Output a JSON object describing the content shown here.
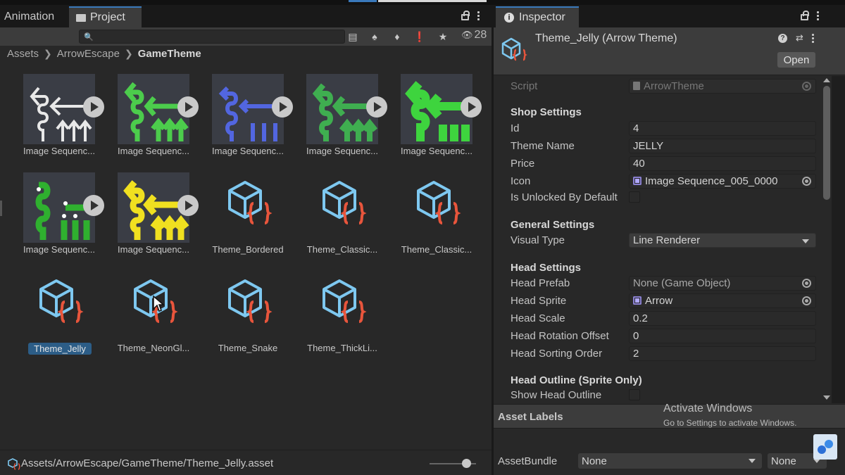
{
  "project": {
    "tabs": [
      {
        "label": "Animation",
        "icon": "animation-icon",
        "active": false
      },
      {
        "label": "Project",
        "icon": "folder-icon",
        "active": true
      }
    ],
    "search": {
      "placeholder": "",
      "value": ""
    },
    "toolbar_icons": [
      "search-by-type-icon",
      "filter-by-type-icon",
      "filter-by-label-icon",
      "warning-filter-icon",
      "favorite-icon"
    ],
    "visible_count": "28",
    "breadcrumb": [
      "Assets",
      "ArrowEscape",
      "GameTheme"
    ],
    "assets": [
      {
        "label": "Image Sequenc...",
        "type": "image-sequence",
        "colors": {
          "bg": "#3a3d45",
          "fg": "#e8e8e8"
        }
      },
      {
        "label": "Image Sequenc...",
        "type": "image-sequence",
        "colors": {
          "bg": "#3a3d45",
          "fg": "#4ccc4c"
        }
      },
      {
        "label": "Image Sequenc...",
        "type": "image-sequence",
        "colors": {
          "bg": "#3a3d45",
          "fg": "#5266e0"
        }
      },
      {
        "label": "Image Sequenc...",
        "type": "image-sequence",
        "colors": {
          "bg": "#3a3d45",
          "fg": "#3fae50"
        }
      },
      {
        "label": "Image Sequenc...",
        "type": "image-sequence",
        "colors": {
          "bg": "#3a3d45",
          "fg": "#3ed43e"
        }
      },
      {
        "label": "Image Sequenc...",
        "type": "image-sequence",
        "colors": {
          "bg": "#3a3d45",
          "fg": "#2fb02f"
        }
      },
      {
        "label": "Image Sequenc...",
        "type": "image-sequence",
        "colors": {
          "bg": "#3a3d45",
          "fg": "#f0e020"
        }
      },
      {
        "label": "Theme_Bordered",
        "type": "scriptable-object"
      },
      {
        "label": "Theme_Classic...",
        "type": "scriptable-object"
      },
      {
        "label": "Theme_Classic...",
        "type": "scriptable-object"
      },
      {
        "label": "Theme_Jelly",
        "type": "scriptable-object",
        "selected": true
      },
      {
        "label": "Theme_NeonGl...",
        "type": "scriptable-object"
      },
      {
        "label": "Theme_Snake",
        "type": "scriptable-object"
      },
      {
        "label": "Theme_ThickLi...",
        "type": "scriptable-object"
      }
    ],
    "status_path": "Assets/ArrowEscape/GameTheme/Theme_Jelly.asset",
    "zoom_level": 0.75
  },
  "inspector": {
    "tab_label": "Inspector",
    "title": "Theme_Jelly (Arrow Theme)",
    "open_label": "Open",
    "script": {
      "label": "Script",
      "value": "ArrowTheme"
    },
    "sections": {
      "shop": "Shop Settings",
      "general": "General Settings",
      "head": "Head Settings",
      "outline": "Head Outline (Sprite Only)"
    },
    "fields": {
      "id": {
        "label": "Id",
        "value": "4"
      },
      "theme_name": {
        "label": "Theme Name",
        "value": "JELLY"
      },
      "price": {
        "label": "Price",
        "value": "40"
      },
      "icon": {
        "label": "Icon",
        "value": "Image Sequence_005_0000"
      },
      "unlocked": {
        "label": "Is Unlocked By Default",
        "checked": false
      },
      "visual_type": {
        "label": "Visual Type",
        "value": "Line Renderer"
      },
      "head_prefab": {
        "label": "Head Prefab",
        "value": "None (Game Object)"
      },
      "head_sprite": {
        "label": "Head Sprite",
        "value": "Arrow"
      },
      "head_scale": {
        "label": "Head Scale",
        "value": "0.2"
      },
      "head_rotation": {
        "label": "Head Rotation Offset",
        "value": "0"
      },
      "head_sorting": {
        "label": "Head Sorting Order",
        "value": "2"
      },
      "show_outline": {
        "label": "Show Head Outline",
        "checked": false
      }
    },
    "asset_labels": "Asset Labels",
    "asset_bundle": {
      "label": "AssetBundle",
      "value": "None",
      "variant": "None"
    }
  },
  "watermark": {
    "line1": "Activate Windows",
    "line2": "Go to Settings to activate Windows."
  },
  "colors": {
    "accent": "#3a79bb",
    "selection": "#2c5d87",
    "so_cube": "#7ec8f0",
    "so_braces": "#e8553c"
  }
}
